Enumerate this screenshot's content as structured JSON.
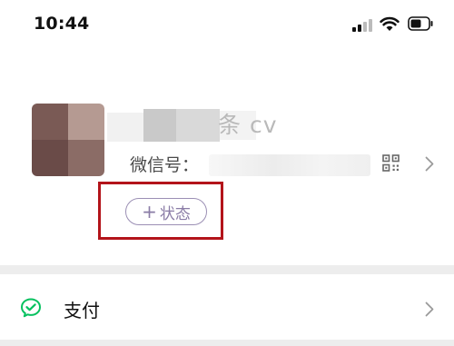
{
  "status_bar": {
    "time": "10:44"
  },
  "profile": {
    "nickname_visible_fragment": "条 cv",
    "wechat_id_label": "微信号：",
    "status_button": {
      "plus": "+",
      "label": "状态"
    }
  },
  "menu": {
    "items": [
      {
        "label": "支付",
        "icon": "wechat-pay-icon"
      }
    ]
  },
  "colors": {
    "accent_purple": "#8a7ca6",
    "highlight_red": "#b3141a",
    "pay_green": "#07c160"
  }
}
